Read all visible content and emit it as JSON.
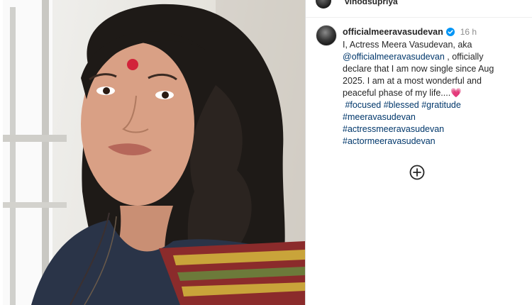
{
  "top": {
    "username": "vinodsupriya"
  },
  "comment": {
    "username": "officialmeeravasudevan",
    "time": "16 h",
    "lines": [
      "I, Actress Meera Vasudevan, aka",
      "@officialmeeravasudevan",
      ", officially",
      "declare that I am now single since Aug",
      "2025. I am at a most wonderful and",
      "peaceful phase of my life....",
      "💗"
    ],
    "hashtags": [
      "#focused",
      "#blessed",
      "#gratitude",
      "#meeravasudevan",
      "#actressmeeravasudevan",
      "#actormeeravasudevan"
    ]
  },
  "icons": {
    "verified": "verified-badge-icon",
    "add": "add-circle-icon"
  },
  "colors": {
    "link": "#00376b",
    "verified": "#0095f6",
    "heart": "#f7559a",
    "text": "#262626",
    "muted": "#8e8e8e"
  }
}
